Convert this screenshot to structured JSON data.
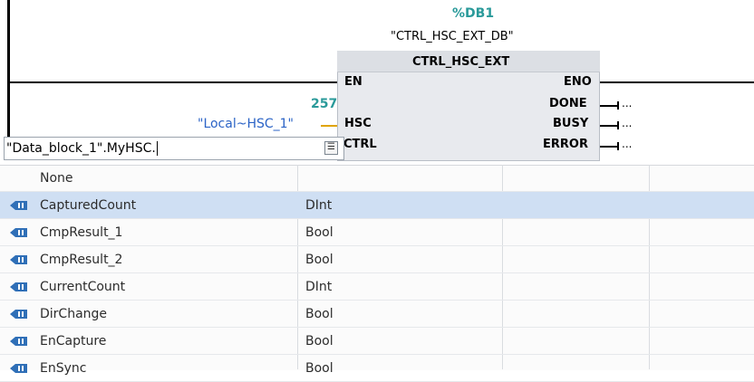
{
  "instance": {
    "db_number": "%DB1",
    "db_name": "\"CTRL_HSC_EXT_DB\""
  },
  "block": {
    "name": "CTRL_HSC_EXT",
    "inputs": {
      "en": "EN",
      "hsc": "HSC",
      "ctrl": "CTRL"
    },
    "outputs": {
      "eno": "ENO",
      "done": "DONE",
      "busy": "BUSY",
      "error": "ERROR"
    },
    "output_placeholder": "..."
  },
  "hsc_param": {
    "value": "257",
    "tag": "\"Local~HSC_1\""
  },
  "ctrl_input": {
    "value": "\"Data_block_1\".MyHSC."
  },
  "colors": {
    "selected_row": "#cfdff3",
    "teal": "#2a9a9a",
    "tag_blue": "#2b63c6"
  },
  "dropdown": {
    "rows": [
      {
        "name": "None",
        "type": "",
        "icon": ""
      },
      {
        "name": "CapturedCount",
        "type": "DInt",
        "icon": "variable-output-icon",
        "selected": true
      },
      {
        "name": "CmpResult_1",
        "type": "Bool",
        "icon": "variable-output-icon"
      },
      {
        "name": "CmpResult_2",
        "type": "Bool",
        "icon": "variable-output-icon"
      },
      {
        "name": "CurrentCount",
        "type": "DInt",
        "icon": "variable-output-icon"
      },
      {
        "name": "DirChange",
        "type": "Bool",
        "icon": "variable-output-icon"
      },
      {
        "name": "EnCapture",
        "type": "Bool",
        "icon": "variable-output-icon"
      },
      {
        "name": "EnSync",
        "type": "Bool",
        "icon": "variable-output-icon"
      }
    ]
  }
}
